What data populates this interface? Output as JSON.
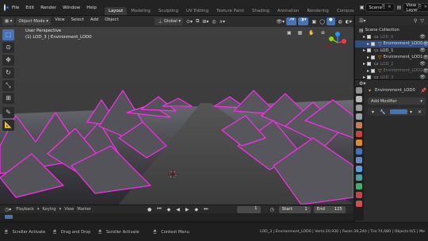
{
  "topbar": {
    "menus": [
      "File",
      "Edit",
      "Render",
      "Window",
      "Help"
    ],
    "workspaces": [
      "Layout",
      "Modeling",
      "Sculpting",
      "UV Editing",
      "Texture Paint",
      "Shading",
      "Animation",
      "Rendering",
      "Compos"
    ],
    "active_workspace": "Layout",
    "scene_label": "Scene",
    "view_layer_label": "View Layer"
  },
  "viewport_header": {
    "mode": "Object Mode",
    "menus": [
      "View",
      "Select",
      "Add",
      "Object"
    ],
    "orientation": "Global"
  },
  "viewport": {
    "view_name": "User Perspective",
    "collection_info": "(1) LOD_3 | Environment_LOD0"
  },
  "outliner": {
    "title": "Scene Collection",
    "rows": [
      {
        "label": "LOD_0",
        "dim": true,
        "indent": 1,
        "type": "collection"
      },
      {
        "label": "Environment_LOD0",
        "dim": false,
        "indent": 2,
        "type": "mesh",
        "selected": true
      },
      {
        "label": "LOD_1",
        "dim": false,
        "indent": 1,
        "type": "collection"
      },
      {
        "label": "Environment_LOD1",
        "dim": false,
        "indent": 2,
        "type": "mesh"
      },
      {
        "label": "LOD_2",
        "dim": true,
        "indent": 1,
        "type": "collection"
      },
      {
        "label": "Environment_LOD2",
        "dim": true,
        "indent": 2,
        "type": "mesh"
      },
      {
        "label": "LOD_3",
        "dim": true,
        "indent": 1,
        "type": "collection"
      }
    ]
  },
  "properties": {
    "object_name": "Environment_LOD0",
    "add_modifier": "Add Modifier"
  },
  "timeline": {
    "menus": [
      "Playback",
      "Keying",
      "View",
      "Marker"
    ],
    "current_frame": "1",
    "start_label": "Start",
    "start_value": "1",
    "end_label": "End",
    "end_value": "125"
  },
  "statusbar": {
    "left_items": [
      "Scroller Activate",
      "Drag and Drop",
      "Scroller Activate",
      "Context Menu"
    ],
    "stats": "LOD_3 | Environment_LOD0 | Verts:20,930 | Faces:39,240 | Tris:74,680 | Objects:0/1 | Me"
  },
  "colors": {
    "accent_blue": "#4772b3",
    "wireframe_magenta": "#ff2bf0",
    "selection_row": "#334d80"
  }
}
